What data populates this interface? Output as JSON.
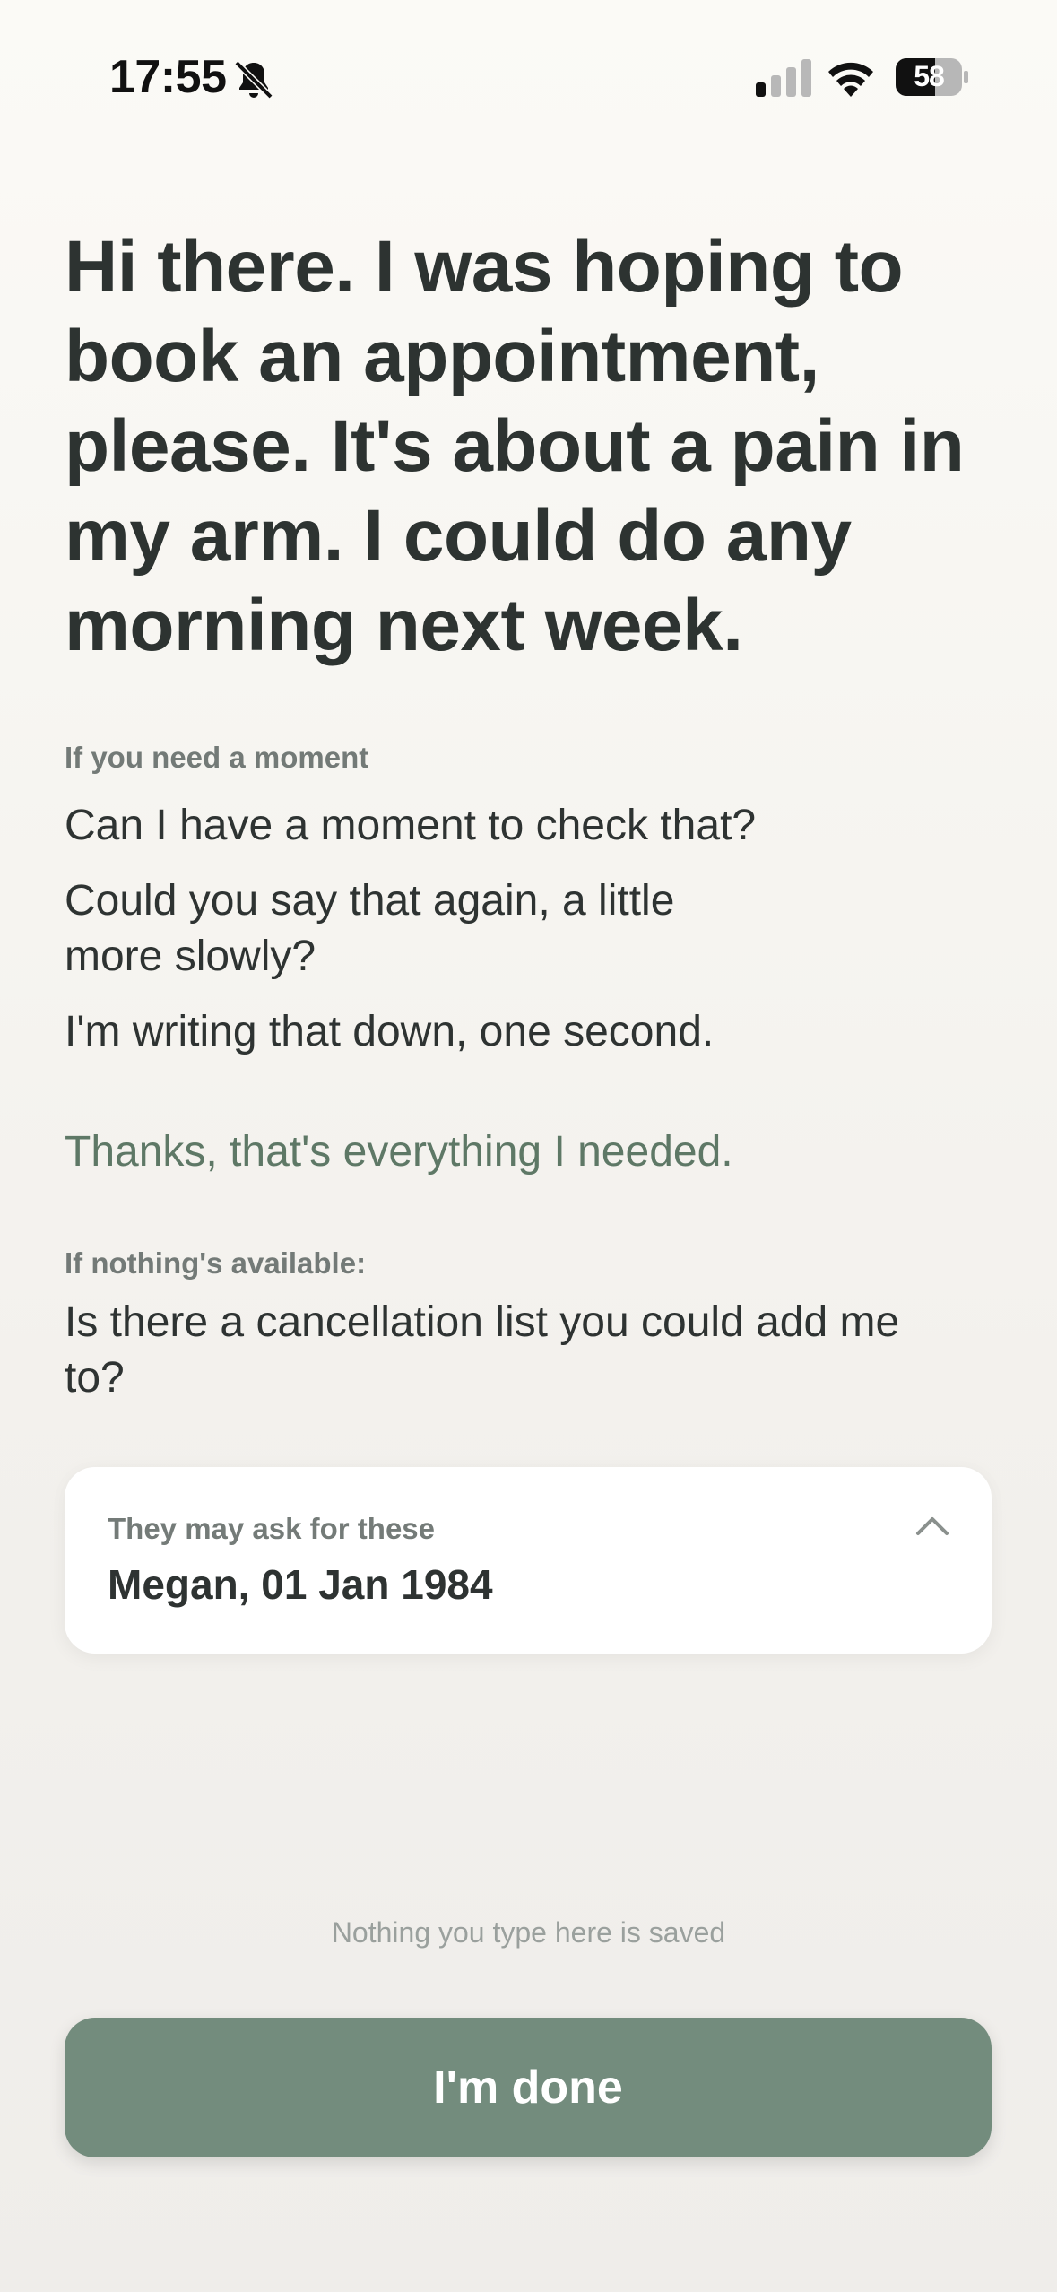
{
  "status_bar": {
    "time": "17:55",
    "battery": "58",
    "icons": [
      "bell-slash-icon",
      "signal-icon",
      "wifi-icon",
      "battery-icon"
    ]
  },
  "headline": "Hi there. I was hoping to book an appointment, please. It's about a pain in my arm. I could do any morning next week.",
  "moment_section": {
    "label": "If you need a moment",
    "phrases": [
      "Can I have a moment to check that?",
      "Could you say that again, a little more slowly?",
      "I'm writing that down, one second."
    ]
  },
  "closing_phrase": "Thanks, that's everything I needed.",
  "unavailable_section": {
    "label": "If nothing's available:",
    "phrase": "Is there a cancellation list you could add me to?"
  },
  "details_card": {
    "label": "They may ask for these",
    "value": "Megan, 01 Jan 1984",
    "toggle_icon": "chevron-up-icon"
  },
  "privacy_note": "Nothing you type here is saved",
  "done_button": {
    "label": "I'm done"
  },
  "colors": {
    "text": "#2e3332",
    "muted": "#737a77",
    "accent_green": "#5e7866",
    "button": "#738c7d"
  }
}
